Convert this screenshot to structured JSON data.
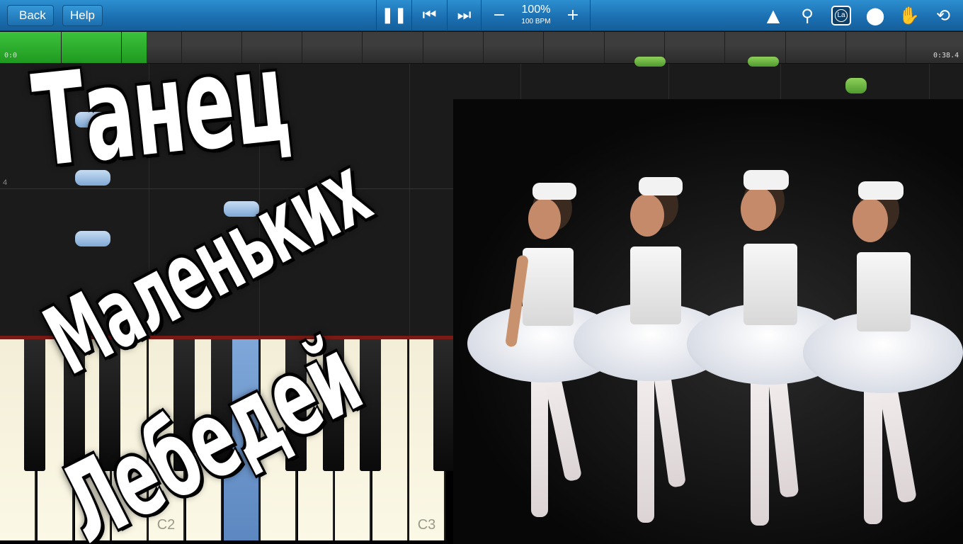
{
  "toolbar": {
    "back_label": "Back",
    "help_label": "Help",
    "tempo_percent": "100%",
    "tempo_bpm": "100 BPM",
    "icons": [
      "pause-icon",
      "skip-back-icon",
      "skip-forward-icon",
      "minus-icon",
      "plus-icon",
      "metronome-icon",
      "zoom-icon",
      "note-label-icon",
      "marker-icon",
      "hand-icon",
      "loop-icon"
    ],
    "note_label_text": "La"
  },
  "timeline": {
    "start_time": "0:0",
    "end_time": "0:38.4",
    "progress_fraction": 0.152
  },
  "roll": {
    "measure_number": "4"
  },
  "keyboard": {
    "labels": [
      "C2",
      "C3"
    ]
  },
  "title": {
    "line1": "Танец",
    "line2": "Маленьких",
    "line3": "Лебедей"
  }
}
